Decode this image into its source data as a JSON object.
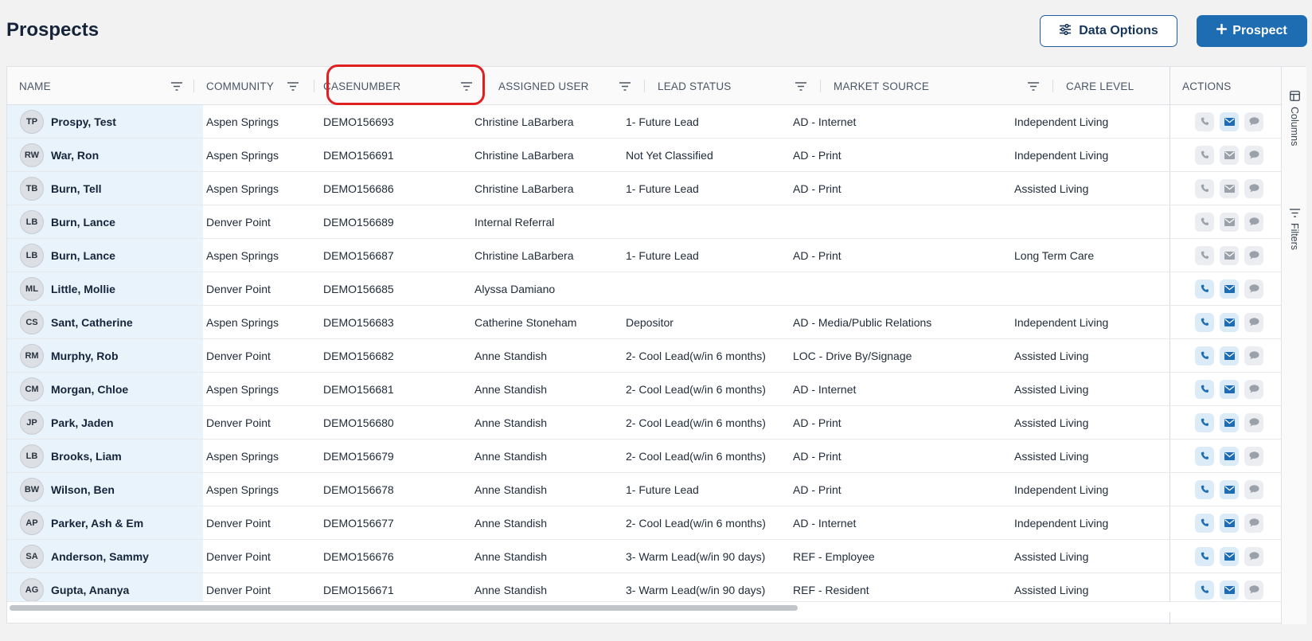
{
  "page": {
    "title": "Prospects"
  },
  "toolbar": {
    "data_options_label": "Data Options",
    "add_prospect_label": "Prospect",
    "add_icon": "plus-icon",
    "options_icon": "sliders-icon"
  },
  "columns": {
    "name": "NAME",
    "community": "COMMUNITY",
    "casenumber": "CASENUMBER",
    "assigned_user": "ASSIGNED USER",
    "lead_status": "LEAD STATUS",
    "market_source": "MARKET SOURCE",
    "care_level": "CARE LEVEL",
    "actions": "ACTIONS"
  },
  "sidebar": {
    "columns_label": "Columns",
    "filters_label": "Filters"
  },
  "rows": [
    {
      "initials": "TP",
      "name": "Prospy, Test",
      "community": "Aspen Springs",
      "case": "DEMO156693",
      "user": "Christine LaBarbera",
      "status": "1- Future Lead",
      "source": "AD - Internet",
      "care": "Independent Living",
      "actions": "partial"
    },
    {
      "initials": "RW",
      "name": "War, Ron",
      "community": "Aspen Springs",
      "case": "DEMO156691",
      "user": "Christine LaBarbera",
      "status": "Not Yet Classified",
      "source": "AD - Print",
      "care": "Independent Living",
      "actions": "off"
    },
    {
      "initials": "TB",
      "name": "Burn, Tell",
      "community": "Aspen Springs",
      "case": "DEMO156686",
      "user": "Christine LaBarbera",
      "status": "1- Future Lead",
      "source": "AD - Print",
      "care": "Assisted Living",
      "actions": "off"
    },
    {
      "initials": "LB",
      "name": "Burn, Lance",
      "community": "Denver Point",
      "case": "DEMO156689",
      "user": "Internal Referral",
      "status": "",
      "source": "",
      "care": "",
      "actions": "off"
    },
    {
      "initials": "LB",
      "name": "Burn, Lance",
      "community": "Aspen Springs",
      "case": "DEMO156687",
      "user": "Christine LaBarbera",
      "status": "1- Future Lead",
      "source": "AD - Print",
      "care": "Long Term Care",
      "actions": "off"
    },
    {
      "initials": "ML",
      "name": "Little, Mollie",
      "community": "Denver Point",
      "case": "DEMO156685",
      "user": "Alyssa Damiano",
      "status": "",
      "source": "",
      "care": "",
      "actions": "on"
    },
    {
      "initials": "CS",
      "name": "Sant, Catherine",
      "community": "Aspen Springs",
      "case": "DEMO156683",
      "user": "Catherine Stoneham",
      "status": "Depositor",
      "source": "AD - Media/Public Relations",
      "care": "Independent Living",
      "actions": "on"
    },
    {
      "initials": "RM",
      "name": "Murphy, Rob",
      "community": "Denver Point",
      "case": "DEMO156682",
      "user": "Anne Standish",
      "status": "2- Cool Lead(w/in 6 months)",
      "source": "LOC - Drive By/Signage",
      "care": "Assisted Living",
      "actions": "on"
    },
    {
      "initials": "CM",
      "name": "Morgan, Chloe",
      "community": "Aspen Springs",
      "case": "DEMO156681",
      "user": "Anne Standish",
      "status": "2- Cool Lead(w/in 6 months)",
      "source": "AD - Internet",
      "care": "Assisted Living",
      "actions": "on"
    },
    {
      "initials": "JP",
      "name": "Park, Jaden",
      "community": "Denver Point",
      "case": "DEMO156680",
      "user": "Anne Standish",
      "status": "2- Cool Lead(w/in 6 months)",
      "source": "AD - Print",
      "care": "Assisted Living",
      "actions": "on"
    },
    {
      "initials": "LB",
      "name": "Brooks, Liam",
      "community": "Aspen Springs",
      "case": "DEMO156679",
      "user": "Anne Standish",
      "status": "2- Cool Lead(w/in 6 months)",
      "source": "AD - Print",
      "care": "Assisted Living",
      "actions": "on"
    },
    {
      "initials": "BW",
      "name": "Wilson, Ben",
      "community": "Aspen Springs",
      "case": "DEMO156678",
      "user": "Anne Standish",
      "status": "1- Future Lead",
      "source": "AD - Print",
      "care": "Independent Living",
      "actions": "on"
    },
    {
      "initials": "AP",
      "name": "Parker, Ash & Em",
      "community": "Denver Point",
      "case": "DEMO156677",
      "user": "Anne Standish",
      "status": "2- Cool Lead(w/in 6 months)",
      "source": "AD - Internet",
      "care": "Independent Living",
      "actions": "on"
    },
    {
      "initials": "SA",
      "name": "Anderson, Sammy",
      "community": "Denver Point",
      "case": "DEMO156676",
      "user": "Anne Standish",
      "status": "3- Warm Lead(w/in 90 days)",
      "source": "REF - Employee",
      "care": "Assisted Living",
      "actions": "on"
    },
    {
      "initials": "AG",
      "name": "Gupta, Ananya",
      "community": "Denver Point",
      "case": "DEMO156671",
      "user": "Anne Standish",
      "status": "3- Warm Lead(w/in 90 days)",
      "source": "REF - Resident",
      "care": "Assisted Living",
      "actions": "on"
    }
  ],
  "colors": {
    "accent": "#1e6db3",
    "highlight": "#e02020",
    "active_icon": "#1e6db3",
    "inactive_icon": "#9aa1aa"
  }
}
